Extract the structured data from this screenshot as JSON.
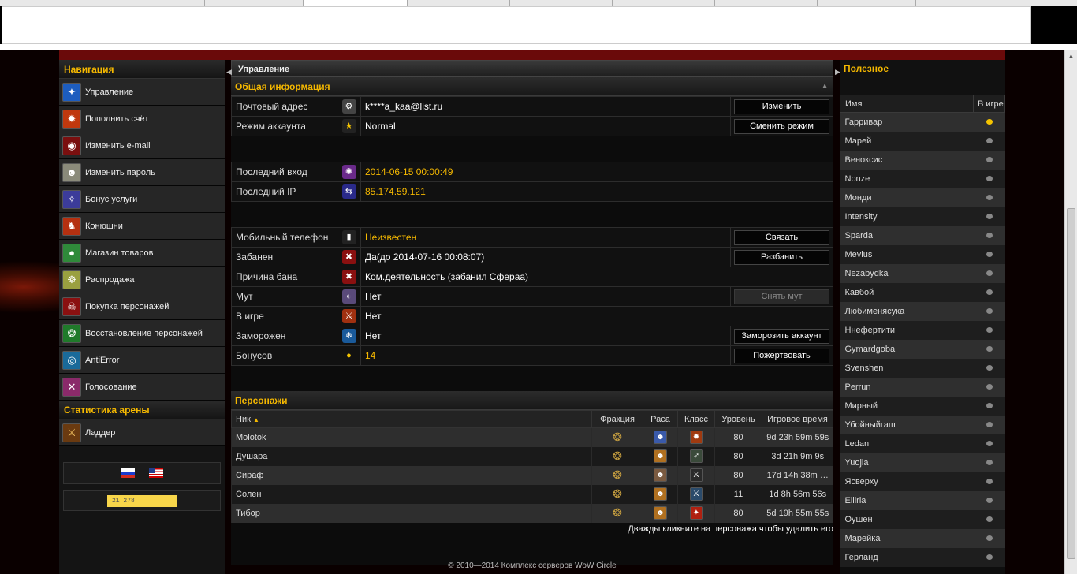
{
  "nav": {
    "title": "Навигация",
    "items": [
      {
        "label": "Управление",
        "icon": "manage-icon",
        "color": "#1d5dbf",
        "glyph": "✦"
      },
      {
        "label": "Пополнить счёт",
        "icon": "payment-icon",
        "color": "#c0380e",
        "glyph": "✹"
      },
      {
        "label": "Изменить e-mail",
        "icon": "email-icon",
        "color": "#7a0f0f",
        "glyph": "◉"
      },
      {
        "label": "Изменить пароль",
        "icon": "password-icon",
        "color": "#8a8a7a",
        "glyph": "☻"
      },
      {
        "label": "Бонус услуги",
        "icon": "bonus-icon",
        "color": "#3c3c9a",
        "glyph": "✧"
      },
      {
        "label": "Конюшни",
        "icon": "stable-icon",
        "color": "#b53010",
        "glyph": "♞"
      },
      {
        "label": "Магазин товаров",
        "icon": "shop-icon",
        "color": "#2f8a3a",
        "glyph": "●"
      },
      {
        "label": "Распродажа",
        "icon": "sale-icon",
        "color": "#9aa040",
        "glyph": "☸"
      },
      {
        "label": "Покупка персонажей",
        "icon": "buy-character-icon",
        "color": "#8a1010",
        "glyph": "☠"
      },
      {
        "label": "Восстановление персонажей",
        "icon": "restore-character-icon",
        "color": "#1f7a2a",
        "glyph": "❂"
      },
      {
        "label": "AntiError",
        "icon": "antierror-icon",
        "color": "#1a6a9a",
        "glyph": "◎"
      },
      {
        "label": "Голосование",
        "icon": "vote-icon",
        "color": "#8a2a6a",
        "glyph": "✕"
      }
    ]
  },
  "arena": {
    "title": "Статистика арены",
    "ladder_label": "Ладдер",
    "ladder_icon": "ladder-icon"
  },
  "counter": {
    "text": "21 278"
  },
  "breadcrumb": "Управление",
  "general": {
    "title": "Общая информация",
    "rows1": [
      {
        "label": "Почтовый адрес",
        "icon": "email-row-icon",
        "value": "k****a_kaa@list.ru",
        "gold": false,
        "action": "Изменить"
      },
      {
        "label": "Режим аккаунта",
        "icon": "star-icon",
        "value": "Normal",
        "gold": false,
        "action": "Сменить режим"
      }
    ],
    "rows2": [
      {
        "label": "Последний вход",
        "icon": "login-icon",
        "value": "2014-06-15 00:00:49",
        "gold": true
      },
      {
        "label": "Последний IP",
        "icon": "ip-icon",
        "value": "85.174.59.121",
        "gold": true
      }
    ],
    "rows3": [
      {
        "label": "Мобильный телефон",
        "icon": "phone-icon",
        "value": "Неизвестен",
        "gold": true,
        "action": "Связать"
      },
      {
        "label": "Забанен",
        "icon": "ban-icon",
        "value": "Да(до 2014-07-16 00:08:07)",
        "gold": false,
        "action": "Разбанить"
      },
      {
        "label": "Причина бана",
        "icon": "ban-reason-icon",
        "value": "Ком.деятельность (забанил Сфераа)",
        "gold": false
      },
      {
        "label": "Мут",
        "icon": "mute-icon",
        "value": "Нет",
        "gold": false,
        "action": "Снять мут",
        "disabled": true
      },
      {
        "label": "В игре",
        "icon": "ingame-icon",
        "value": "Нет",
        "gold": false
      },
      {
        "label": "Заморожен",
        "icon": "frozen-icon",
        "value": "Нет",
        "gold": false,
        "action": "Заморозить аккаунт"
      },
      {
        "label": "Бонусов",
        "icon": "coin-icon",
        "value": "14",
        "gold": true,
        "action": "Пожертвовать"
      }
    ]
  },
  "characters": {
    "title": "Персонажи",
    "headers": {
      "nick": "Ник",
      "faction": "Фракция",
      "race": "Раса",
      "class": "Класс",
      "level": "Уровень",
      "playtime": "Игровое время"
    },
    "rows": [
      {
        "name": "Molotok",
        "level": "80",
        "playtime": "9d 23h 59m 59s",
        "race_icon": "race-draenei-icon",
        "class_icon": "class-warlock-icon"
      },
      {
        "name": "Душара",
        "level": "80",
        "playtime": "3d 21h 9m 9s",
        "race_icon": "race-human-icon",
        "class_icon": "class-hunter-icon"
      },
      {
        "name": "Сираф",
        "level": "80",
        "playtime": "17d 14h 38m …",
        "race_icon": "race-gnome-icon",
        "class_icon": "class-rogue-icon"
      },
      {
        "name": "Солен",
        "level": "11",
        "playtime": "1d 8h 56m 56s",
        "race_icon": "race-human-icon",
        "class_icon": "class-warrior-icon"
      },
      {
        "name": "Тибор",
        "level": "80",
        "playtime": "5d 19h 55m 55s",
        "race_icon": "race-human-icon",
        "class_icon": "class-mage-icon"
      }
    ],
    "hint": "Дважды кликните на персонажа чтобы удалить его"
  },
  "footer": "© 2010—2014 Комплекс серверов WoW Circle",
  "useful": {
    "title": "Полезное",
    "headers": {
      "name": "Имя",
      "online": "В игре"
    },
    "rows": [
      {
        "name": "Гарривар",
        "online": true
      },
      {
        "name": "Марей",
        "online": false
      },
      {
        "name": "Веноксис",
        "online": false
      },
      {
        "name": "Nonze",
        "online": false
      },
      {
        "name": "Монди",
        "online": false
      },
      {
        "name": "Intensity",
        "online": false
      },
      {
        "name": "Sparda",
        "online": false
      },
      {
        "name": "Mevius",
        "online": false
      },
      {
        "name": "Nezabydka",
        "online": false
      },
      {
        "name": "Кавбой",
        "online": false
      },
      {
        "name": "Любименясука",
        "online": false
      },
      {
        "name": "Ннефертити",
        "online": false
      },
      {
        "name": "Gymardgoba",
        "online": false
      },
      {
        "name": "Svenshen",
        "online": false
      },
      {
        "name": "Perrun",
        "online": false
      },
      {
        "name": "Мирный",
        "online": false
      },
      {
        "name": "Убойныйгаш",
        "online": false
      },
      {
        "name": "Ledan",
        "online": false
      },
      {
        "name": "Yuojia",
        "online": false
      },
      {
        "name": "Ясверху",
        "online": false
      },
      {
        "name": "Elliria",
        "online": false
      },
      {
        "name": "Оушен",
        "online": false
      },
      {
        "name": "Марейка",
        "online": false
      },
      {
        "name": "Герланд",
        "online": false
      }
    ]
  },
  "colors": {
    "accent": "#f5b800",
    "online": "#f5c400",
    "offline": "#888888"
  }
}
